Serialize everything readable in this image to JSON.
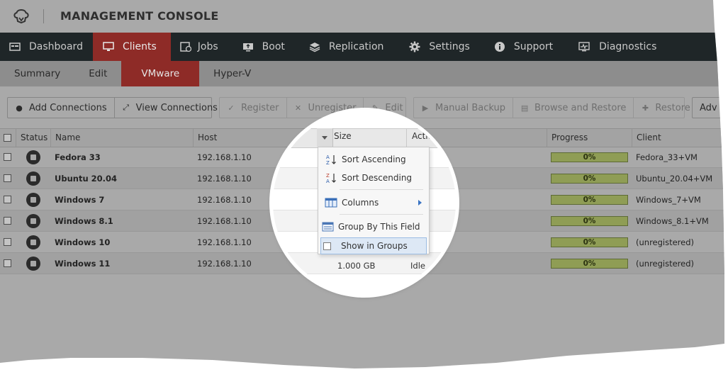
{
  "header": {
    "title": "MANAGEMENT CONSOLE",
    "logo_icon": "cloud-logo-icon"
  },
  "main_nav": [
    {
      "label": "Dashboard",
      "icon": "dashboard-icon",
      "active": false
    },
    {
      "label": "Clients",
      "icon": "monitor-icon",
      "active": true
    },
    {
      "label": "Jobs",
      "icon": "calendar-icon",
      "active": false
    },
    {
      "label": "Boot",
      "icon": "boot-icon",
      "active": false
    },
    {
      "label": "Replication",
      "icon": "layers-icon",
      "active": false
    },
    {
      "label": "Settings",
      "icon": "gear-icon",
      "active": false
    },
    {
      "label": "Support",
      "icon": "info-icon",
      "active": false
    },
    {
      "label": "Diagnostics",
      "icon": "pulse-icon",
      "active": false
    }
  ],
  "sub_nav": [
    {
      "label": "Summary",
      "active": false
    },
    {
      "label": "Edit",
      "active": false
    },
    {
      "label": "VMware",
      "active": true
    },
    {
      "label": "Hyper-V",
      "active": false
    }
  ],
  "toolbar": {
    "add_connections": "Add Connections",
    "view_connections": "View Connections",
    "register": "Register",
    "unregister": "Unregister",
    "edit": "Edit",
    "manual_backup": "Manual Backup",
    "browse_restore": "Browse and Restore",
    "restore": "Restore",
    "advanced_partial": "Adv"
  },
  "grid": {
    "columns": {
      "status": "Status",
      "name": "Name",
      "host": "Host",
      "size": "Size",
      "action": "Action",
      "progress": "Progress",
      "client": "Client"
    },
    "rows": [
      {
        "name": "Fedora 33",
        "host": "192.168.1.10",
        "size": "",
        "action": "",
        "progress": "0%",
        "client": "Fedora_33+VM"
      },
      {
        "name": "Ubuntu 20.04",
        "host": "192.168.1.10",
        "size": "",
        "action": "",
        "progress": "0%",
        "client": "Ubuntu_20.04+VM"
      },
      {
        "name": "Windows 7",
        "host": "192.168.1.10",
        "size": "",
        "action": "",
        "progress": "0%",
        "client": "Windows_7+VM"
      },
      {
        "name": "Windows 8.1",
        "host": "192.168.1.10",
        "size": "",
        "action": "",
        "progress": "0%",
        "client": "Windows_8.1+VM"
      },
      {
        "name": "Windows 10",
        "host": "192.168.1.10",
        "size": "",
        "action": "",
        "progress": "0%",
        "client": "(unregistered)"
      },
      {
        "name": "Windows 11",
        "host": "192.168.1.10",
        "size": "1.000 GB",
        "action": "Idle",
        "progress": "0%",
        "client": "(unregistered)"
      }
    ]
  },
  "column_menu": {
    "sort_ascending": "Sort Ascending",
    "sort_descending": "Sort Descending",
    "columns": "Columns",
    "group_by_field": "Group By This Field",
    "show_in_groups": "Show in Groups"
  },
  "colors": {
    "nav_bg": "#1f2628",
    "active_red": "#8e2b27",
    "progress_green": "#8f9d55"
  }
}
